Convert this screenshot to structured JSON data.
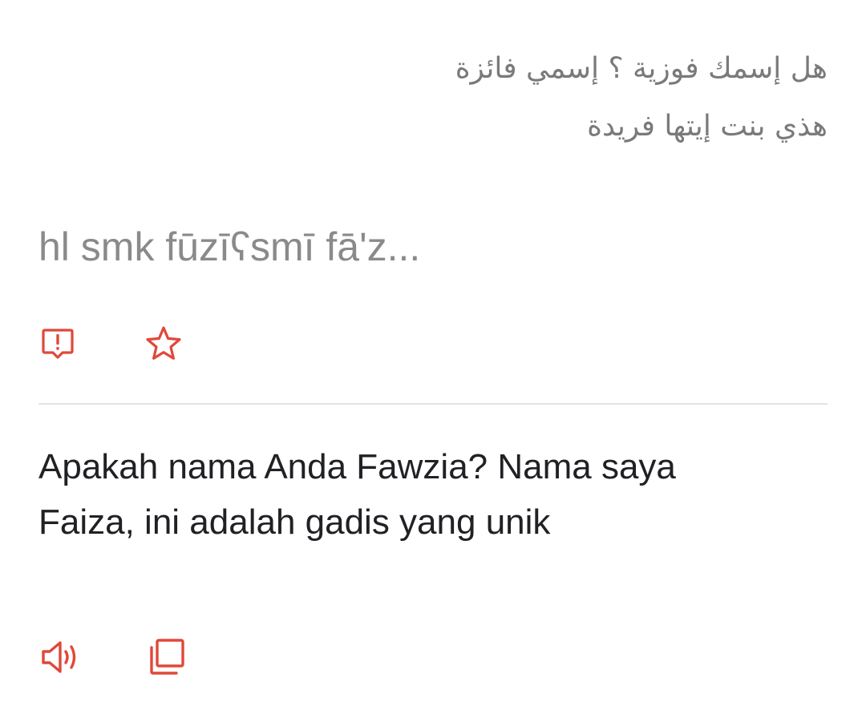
{
  "source": {
    "language_direction": "rtl",
    "lines": [
      "هل إسمك فوزية ؟ إسمي فائزة",
      "هذي بنت إيتها فريدة"
    ]
  },
  "transliteration": {
    "text": "hl smk fūzīʕsmī fā'z..."
  },
  "source_actions": {
    "report_icon": "report-feedback-icon",
    "star_icon": "star-outline-icon"
  },
  "translation": {
    "lines": [
      "Apakah nama Anda Fawzia? Nama saya",
      "Faiza, ini adalah gadis yang unik"
    ]
  },
  "translation_actions": {
    "speaker_icon": "speaker-icon",
    "copy_icon": "copy-icon"
  },
  "colors": {
    "accent": "#e0483a",
    "source_text": "#7a7a7a",
    "transliteration_text": "#8a8a8a",
    "translation_text": "#202124",
    "divider": "#e3e3e3",
    "background": "#ffffff"
  }
}
